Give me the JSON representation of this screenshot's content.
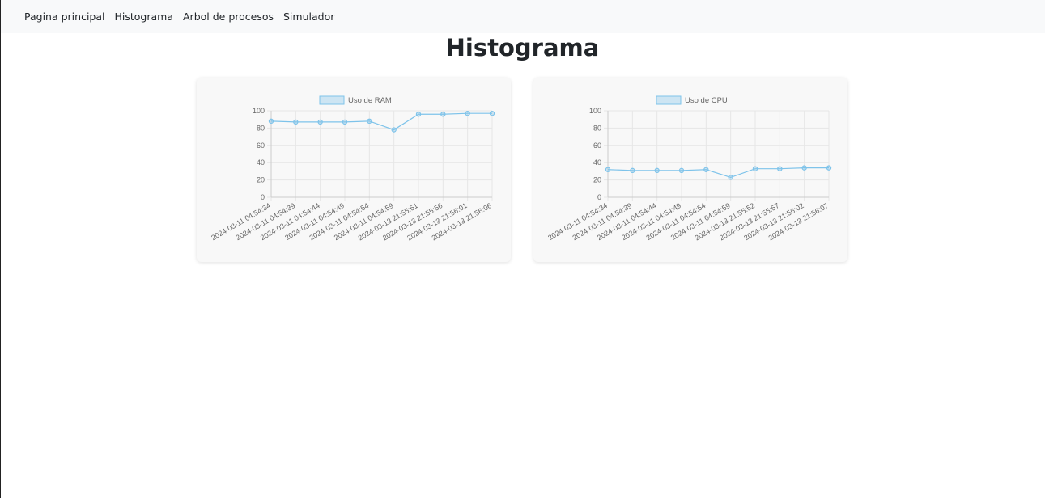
{
  "nav": {
    "items": [
      "Pagina principal",
      "Histograma",
      "Arbol de procesos",
      "Simulador"
    ]
  },
  "page_title": "Histograma",
  "colors": {
    "line": "#7ec3ea",
    "fill": "rgba(126,195,234,0.35)",
    "grid": "#e6e6e6"
  },
  "chart_data": [
    {
      "type": "line",
      "title": "",
      "xlabel": "",
      "ylabel": "",
      "ylim": [
        0,
        100
      ],
      "yticks": [
        0,
        20,
        40,
        60,
        80,
        100
      ],
      "grid": true,
      "legend_position": "top",
      "x": [
        "2024-03-11 04:54:34",
        "2024-03-11 04:54:39",
        "2024-03-11 04:54:44",
        "2024-03-11 04:54:49",
        "2024-03-11 04:54:54",
        "2024-03-11 04:54:59",
        "2024-03-13 21:55:51",
        "2024-03-13 21:55:56",
        "2024-03-13 21:56:01",
        "2024-03-13 21:56:06"
      ],
      "series": [
        {
          "name": "Uso de RAM",
          "values": [
            88,
            87,
            87,
            87,
            88,
            78,
            96,
            96,
            97,
            97
          ]
        }
      ]
    },
    {
      "type": "line",
      "title": "",
      "xlabel": "",
      "ylabel": "",
      "ylim": [
        0,
        100
      ],
      "yticks": [
        0,
        20,
        40,
        60,
        80,
        100
      ],
      "grid": true,
      "legend_position": "top",
      "x": [
        "2024-03-11 04:54:34",
        "2024-03-11 04:54:39",
        "2024-03-11 04:54:44",
        "2024-03-11 04:54:49",
        "2024-03-11 04:54:54",
        "2024-03-11 04:54:59",
        "2024-03-13 21:55:52",
        "2024-03-13 21:55:57",
        "2024-03-13 21:56:02",
        "2024-03-13 21:56:07"
      ],
      "series": [
        {
          "name": "Uso de CPU",
          "values": [
            32,
            31,
            31,
            31,
            32,
            23,
            33,
            33,
            34,
            34
          ]
        }
      ]
    }
  ]
}
